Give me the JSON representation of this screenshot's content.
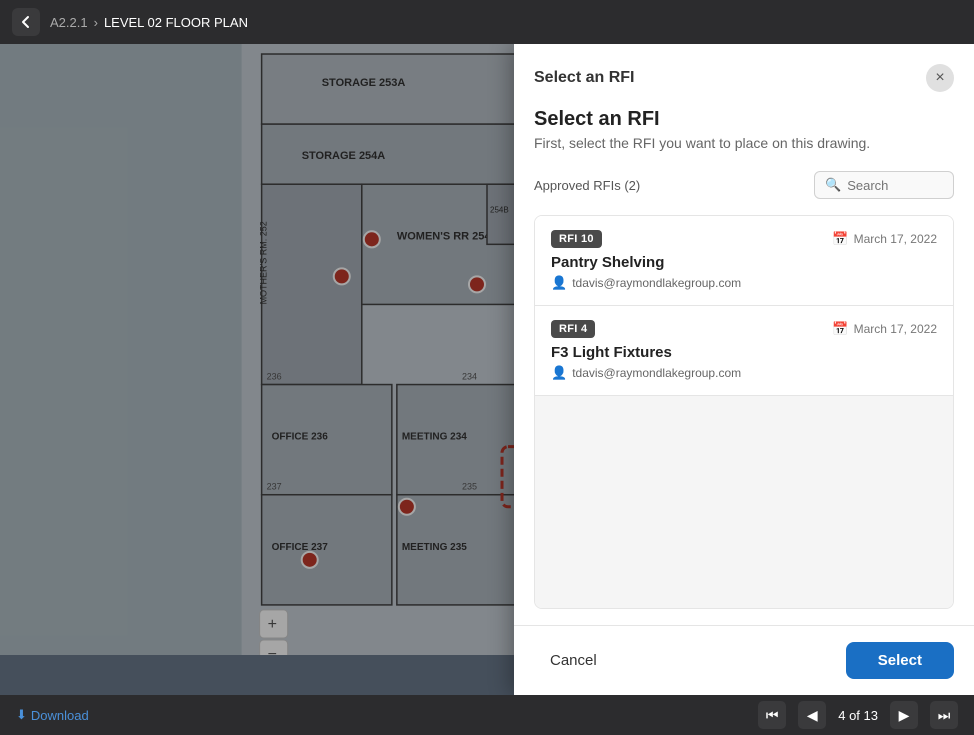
{
  "topbar": {
    "back_label": "‹",
    "breadcrumb_prefix": "A2.2.1",
    "breadcrumb_title": "LEVEL 02 FLOOR PLAN"
  },
  "bottombar": {
    "download_label": "Download",
    "page_current": "4",
    "page_total": "13"
  },
  "modal": {
    "header_title": "Select an RFI",
    "close_label": "×",
    "subtitle": "Select an RFI",
    "description": "First, select the RFI you want to place on this drawing.",
    "filter_label": "Approved RFIs (2)",
    "search_placeholder": "Search",
    "rfi_items": [
      {
        "badge": "RFI 10",
        "date": "March 17, 2022",
        "name": "Pantry Shelving",
        "email": "tdavis@raymondlakegroup.com"
      },
      {
        "badge": "RFI 4",
        "date": "March 17, 2022",
        "name": "F3 Light Fixtures",
        "email": "tdavis@raymondlakegroup.com"
      }
    ],
    "cancel_label": "Cancel",
    "select_label": "Select"
  }
}
